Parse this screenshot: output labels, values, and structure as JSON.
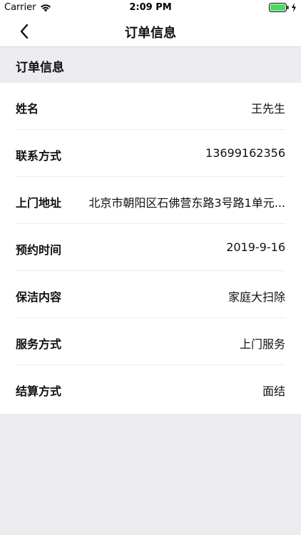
{
  "status_bar": {
    "carrier": "Carrier",
    "time": "2:09 PM",
    "icons": [
      "wifi-icon",
      "battery-icon",
      "charging-icon"
    ]
  },
  "nav": {
    "title": "订单信息",
    "back_icon": "chevron-left-icon"
  },
  "section": {
    "title": "订单信息"
  },
  "rows": [
    {
      "label": "姓名",
      "value": "王先生"
    },
    {
      "label": "联系方式",
      "value": "13699162356"
    },
    {
      "label": "上门地址",
      "value": "北京市朝阳区石佛营东路3号路1单元..."
    },
    {
      "label": "预约时间",
      "value": "2019-9-16"
    },
    {
      "label": "保洁内容",
      "value": "家庭大扫除"
    },
    {
      "label": "服务方式",
      "value": "上门服务"
    },
    {
      "label": "结算方式",
      "value": "面结"
    }
  ],
  "colors": {
    "background": "#ececf0",
    "card": "#ffffff",
    "battery_fill": "#4cd964",
    "text": "#111111"
  }
}
